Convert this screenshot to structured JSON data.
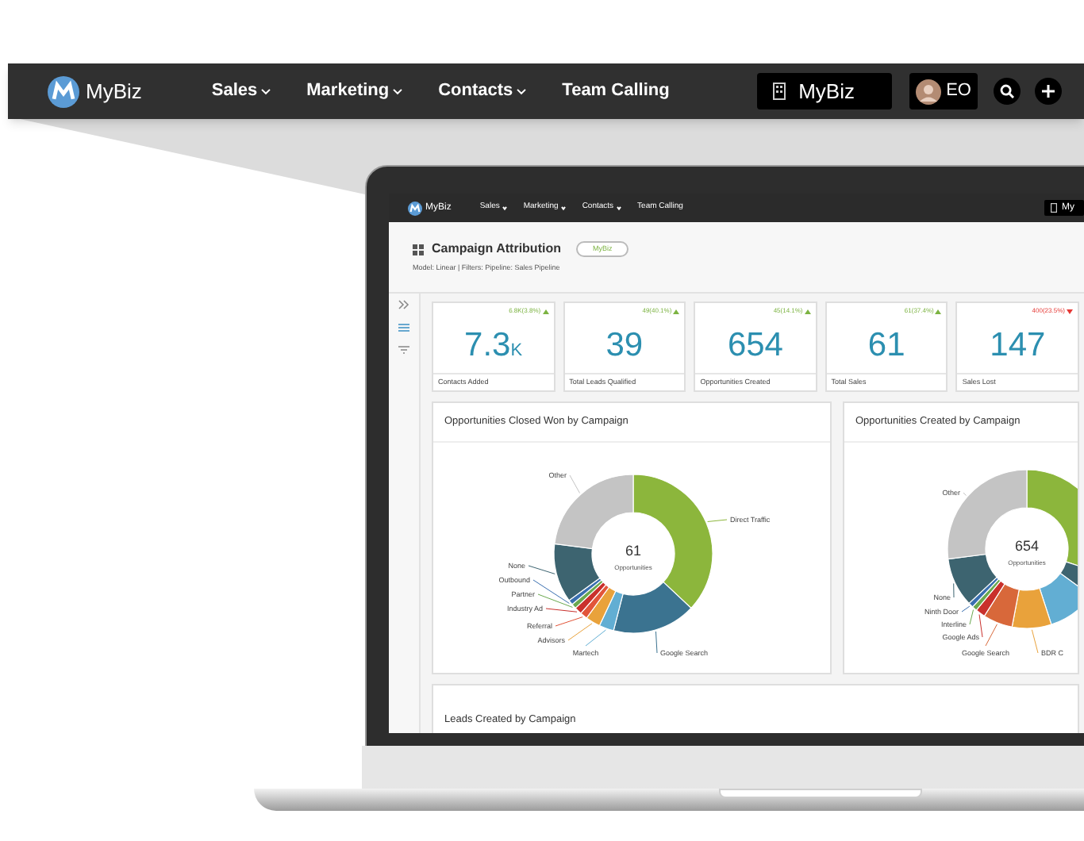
{
  "nav": {
    "logo": "MyBiz",
    "items": [
      {
        "label": "Sales",
        "dropdown": true
      },
      {
        "label": "Marketing",
        "dropdown": true
      },
      {
        "label": "Contacts",
        "dropdown": true
      },
      {
        "label": "Team Calling",
        "dropdown": false
      }
    ],
    "account": "MyBiz",
    "user_initials": "EO"
  },
  "laptop_screen": {
    "nav": {
      "logo": "MyBiz",
      "items": [
        {
          "label": "Sales",
          "dropdown": true
        },
        {
          "label": "Marketing",
          "dropdown": true
        },
        {
          "label": "Contacts",
          "dropdown": true
        },
        {
          "label": "Team Calling",
          "dropdown": false
        }
      ],
      "account": "My"
    },
    "page_title": "Campaign Attribution",
    "badge": "MyBiz",
    "subtitle": "Model: Linear | Filters: Pipeline: Sales Pipeline",
    "kpis": [
      {
        "delta": "6.8K(3.8%)",
        "rising": true,
        "value": "7.3",
        "suffix": "K",
        "label": "Contacts Added"
      },
      {
        "delta": "49(40.1%)",
        "rising": true,
        "value": "39",
        "label": "Total Leads Qualified"
      },
      {
        "delta": "45(14.1%)",
        "rising": true,
        "value": "654",
        "label": "Opportunities Created"
      },
      {
        "delta": "61(37.4%)",
        "rising": true,
        "value": "61",
        "label": "Total Sales"
      },
      {
        "delta": "400(23.5%)",
        "rising": false,
        "value": "147",
        "label": "Sales Lost"
      }
    ],
    "charts": [
      {
        "title": "Opportunities Closed Won by Campaign",
        "center_value": "61",
        "center_label": "Opportunities",
        "labels": [
          {
            "text": "Other",
            "color": "#c4c4c4"
          },
          {
            "text": "Direct Traffic",
            "color": "#8cb63c"
          },
          {
            "text": "None",
            "color": "#3d6470"
          },
          {
            "text": "Outbound",
            "color": "#3a6fb0"
          },
          {
            "text": "Partner",
            "color": "#6aa84f"
          },
          {
            "text": "Industry Ad",
            "color": "#c9302c"
          },
          {
            "text": "Referral",
            "color": "#e2553a"
          },
          {
            "text": "Advisors",
            "color": "#e9a23b"
          },
          {
            "text": "Martech",
            "color": "#62aed3"
          },
          {
            "text": "Google Search",
            "color": "#3b7390"
          }
        ]
      },
      {
        "title": "Opportunities Created by Campaign",
        "center_value": "654",
        "center_label": "Opportunities",
        "labels": [
          {
            "text": "Other",
            "color": "#c4c4c4"
          },
          {
            "text": "None",
            "color": "#3d6470"
          },
          {
            "text": "Ninth Door",
            "color": "#3a6fb0"
          },
          {
            "text": "Interline",
            "color": "#6aa84f"
          },
          {
            "text": "Google Ads",
            "color": "#c9302c"
          },
          {
            "text": "Google Search",
            "color": "#d8683a"
          },
          {
            "text": "BDR C",
            "color": "#e9a23b"
          }
        ]
      }
    ],
    "bottom_panel": {
      "title": "Leads Created by Campaign"
    }
  }
}
